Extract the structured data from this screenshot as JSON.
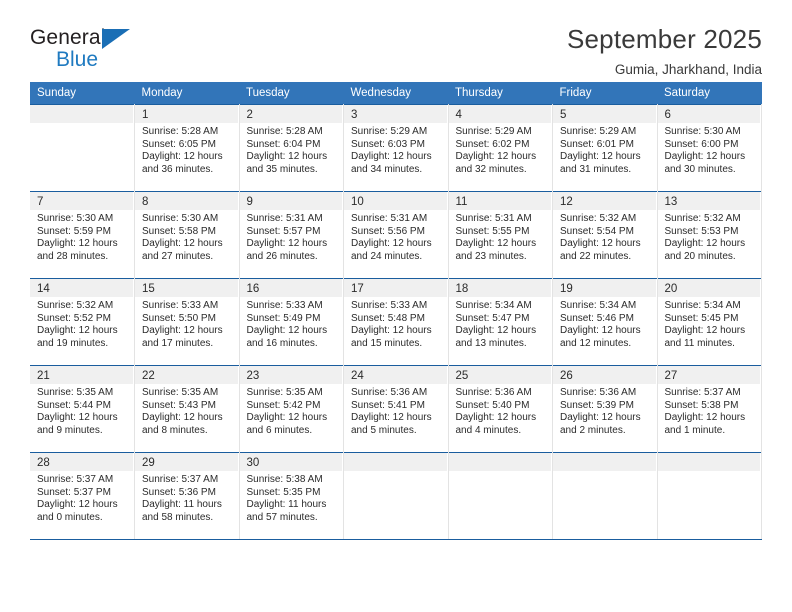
{
  "logo": {
    "word_one": "General",
    "word_two": "Blue",
    "triangle_color": "#1a6eb5"
  },
  "header": {
    "title": "September 2025",
    "subtitle": "Gumia, Jharkhand, India"
  },
  "theme": {
    "header_bg": "#3275b9",
    "grid_line": "#1a5d9e",
    "daynum_bg": "#f0f0f0",
    "text": "#2b2b2b"
  },
  "weekday_headers": [
    "Sunday",
    "Monday",
    "Tuesday",
    "Wednesday",
    "Thursday",
    "Friday",
    "Saturday"
  ],
  "weeks": [
    [
      {
        "day": "",
        "sunrise": "",
        "sunset": "",
        "daylight1": "",
        "daylight2": ""
      },
      {
        "day": "1",
        "sunrise": "Sunrise: 5:28 AM",
        "sunset": "Sunset: 6:05 PM",
        "daylight1": "Daylight: 12 hours",
        "daylight2": "and 36 minutes."
      },
      {
        "day": "2",
        "sunrise": "Sunrise: 5:28 AM",
        "sunset": "Sunset: 6:04 PM",
        "daylight1": "Daylight: 12 hours",
        "daylight2": "and 35 minutes."
      },
      {
        "day": "3",
        "sunrise": "Sunrise: 5:29 AM",
        "sunset": "Sunset: 6:03 PM",
        "daylight1": "Daylight: 12 hours",
        "daylight2": "and 34 minutes."
      },
      {
        "day": "4",
        "sunrise": "Sunrise: 5:29 AM",
        "sunset": "Sunset: 6:02 PM",
        "daylight1": "Daylight: 12 hours",
        "daylight2": "and 32 minutes."
      },
      {
        "day": "5",
        "sunrise": "Sunrise: 5:29 AM",
        "sunset": "Sunset: 6:01 PM",
        "daylight1": "Daylight: 12 hours",
        "daylight2": "and 31 minutes."
      },
      {
        "day": "6",
        "sunrise": "Sunrise: 5:30 AM",
        "sunset": "Sunset: 6:00 PM",
        "daylight1": "Daylight: 12 hours",
        "daylight2": "and 30 minutes."
      }
    ],
    [
      {
        "day": "7",
        "sunrise": "Sunrise: 5:30 AM",
        "sunset": "Sunset: 5:59 PM",
        "daylight1": "Daylight: 12 hours",
        "daylight2": "and 28 minutes."
      },
      {
        "day": "8",
        "sunrise": "Sunrise: 5:30 AM",
        "sunset": "Sunset: 5:58 PM",
        "daylight1": "Daylight: 12 hours",
        "daylight2": "and 27 minutes."
      },
      {
        "day": "9",
        "sunrise": "Sunrise: 5:31 AM",
        "sunset": "Sunset: 5:57 PM",
        "daylight1": "Daylight: 12 hours",
        "daylight2": "and 26 minutes."
      },
      {
        "day": "10",
        "sunrise": "Sunrise: 5:31 AM",
        "sunset": "Sunset: 5:56 PM",
        "daylight1": "Daylight: 12 hours",
        "daylight2": "and 24 minutes."
      },
      {
        "day": "11",
        "sunrise": "Sunrise: 5:31 AM",
        "sunset": "Sunset: 5:55 PM",
        "daylight1": "Daylight: 12 hours",
        "daylight2": "and 23 minutes."
      },
      {
        "day": "12",
        "sunrise": "Sunrise: 5:32 AM",
        "sunset": "Sunset: 5:54 PM",
        "daylight1": "Daylight: 12 hours",
        "daylight2": "and 22 minutes."
      },
      {
        "day": "13",
        "sunrise": "Sunrise: 5:32 AM",
        "sunset": "Sunset: 5:53 PM",
        "daylight1": "Daylight: 12 hours",
        "daylight2": "and 20 minutes."
      }
    ],
    [
      {
        "day": "14",
        "sunrise": "Sunrise: 5:32 AM",
        "sunset": "Sunset: 5:52 PM",
        "daylight1": "Daylight: 12 hours",
        "daylight2": "and 19 minutes."
      },
      {
        "day": "15",
        "sunrise": "Sunrise: 5:33 AM",
        "sunset": "Sunset: 5:50 PM",
        "daylight1": "Daylight: 12 hours",
        "daylight2": "and 17 minutes."
      },
      {
        "day": "16",
        "sunrise": "Sunrise: 5:33 AM",
        "sunset": "Sunset: 5:49 PM",
        "daylight1": "Daylight: 12 hours",
        "daylight2": "and 16 minutes."
      },
      {
        "day": "17",
        "sunrise": "Sunrise: 5:33 AM",
        "sunset": "Sunset: 5:48 PM",
        "daylight1": "Daylight: 12 hours",
        "daylight2": "and 15 minutes."
      },
      {
        "day": "18",
        "sunrise": "Sunrise: 5:34 AM",
        "sunset": "Sunset: 5:47 PM",
        "daylight1": "Daylight: 12 hours",
        "daylight2": "and 13 minutes."
      },
      {
        "day": "19",
        "sunrise": "Sunrise: 5:34 AM",
        "sunset": "Sunset: 5:46 PM",
        "daylight1": "Daylight: 12 hours",
        "daylight2": "and 12 minutes."
      },
      {
        "day": "20",
        "sunrise": "Sunrise: 5:34 AM",
        "sunset": "Sunset: 5:45 PM",
        "daylight1": "Daylight: 12 hours",
        "daylight2": "and 11 minutes."
      }
    ],
    [
      {
        "day": "21",
        "sunrise": "Sunrise: 5:35 AM",
        "sunset": "Sunset: 5:44 PM",
        "daylight1": "Daylight: 12 hours",
        "daylight2": "and 9 minutes."
      },
      {
        "day": "22",
        "sunrise": "Sunrise: 5:35 AM",
        "sunset": "Sunset: 5:43 PM",
        "daylight1": "Daylight: 12 hours",
        "daylight2": "and 8 minutes."
      },
      {
        "day": "23",
        "sunrise": "Sunrise: 5:35 AM",
        "sunset": "Sunset: 5:42 PM",
        "daylight1": "Daylight: 12 hours",
        "daylight2": "and 6 minutes."
      },
      {
        "day": "24",
        "sunrise": "Sunrise: 5:36 AM",
        "sunset": "Sunset: 5:41 PM",
        "daylight1": "Daylight: 12 hours",
        "daylight2": "and 5 minutes."
      },
      {
        "day": "25",
        "sunrise": "Sunrise: 5:36 AM",
        "sunset": "Sunset: 5:40 PM",
        "daylight1": "Daylight: 12 hours",
        "daylight2": "and 4 minutes."
      },
      {
        "day": "26",
        "sunrise": "Sunrise: 5:36 AM",
        "sunset": "Sunset: 5:39 PM",
        "daylight1": "Daylight: 12 hours",
        "daylight2": "and 2 minutes."
      },
      {
        "day": "27",
        "sunrise": "Sunrise: 5:37 AM",
        "sunset": "Sunset: 5:38 PM",
        "daylight1": "Daylight: 12 hours",
        "daylight2": "and 1 minute."
      }
    ],
    [
      {
        "day": "28",
        "sunrise": "Sunrise: 5:37 AM",
        "sunset": "Sunset: 5:37 PM",
        "daylight1": "Daylight: 12 hours",
        "daylight2": "and 0 minutes."
      },
      {
        "day": "29",
        "sunrise": "Sunrise: 5:37 AM",
        "sunset": "Sunset: 5:36 PM",
        "daylight1": "Daylight: 11 hours",
        "daylight2": "and 58 minutes."
      },
      {
        "day": "30",
        "sunrise": "Sunrise: 5:38 AM",
        "sunset": "Sunset: 5:35 PM",
        "daylight1": "Daylight: 11 hours",
        "daylight2": "and 57 minutes."
      },
      {
        "day": "",
        "sunrise": "",
        "sunset": "",
        "daylight1": "",
        "daylight2": ""
      },
      {
        "day": "",
        "sunrise": "",
        "sunset": "",
        "daylight1": "",
        "daylight2": ""
      },
      {
        "day": "",
        "sunrise": "",
        "sunset": "",
        "daylight1": "",
        "daylight2": ""
      },
      {
        "day": "",
        "sunrise": "",
        "sunset": "",
        "daylight1": "",
        "daylight2": ""
      }
    ]
  ]
}
